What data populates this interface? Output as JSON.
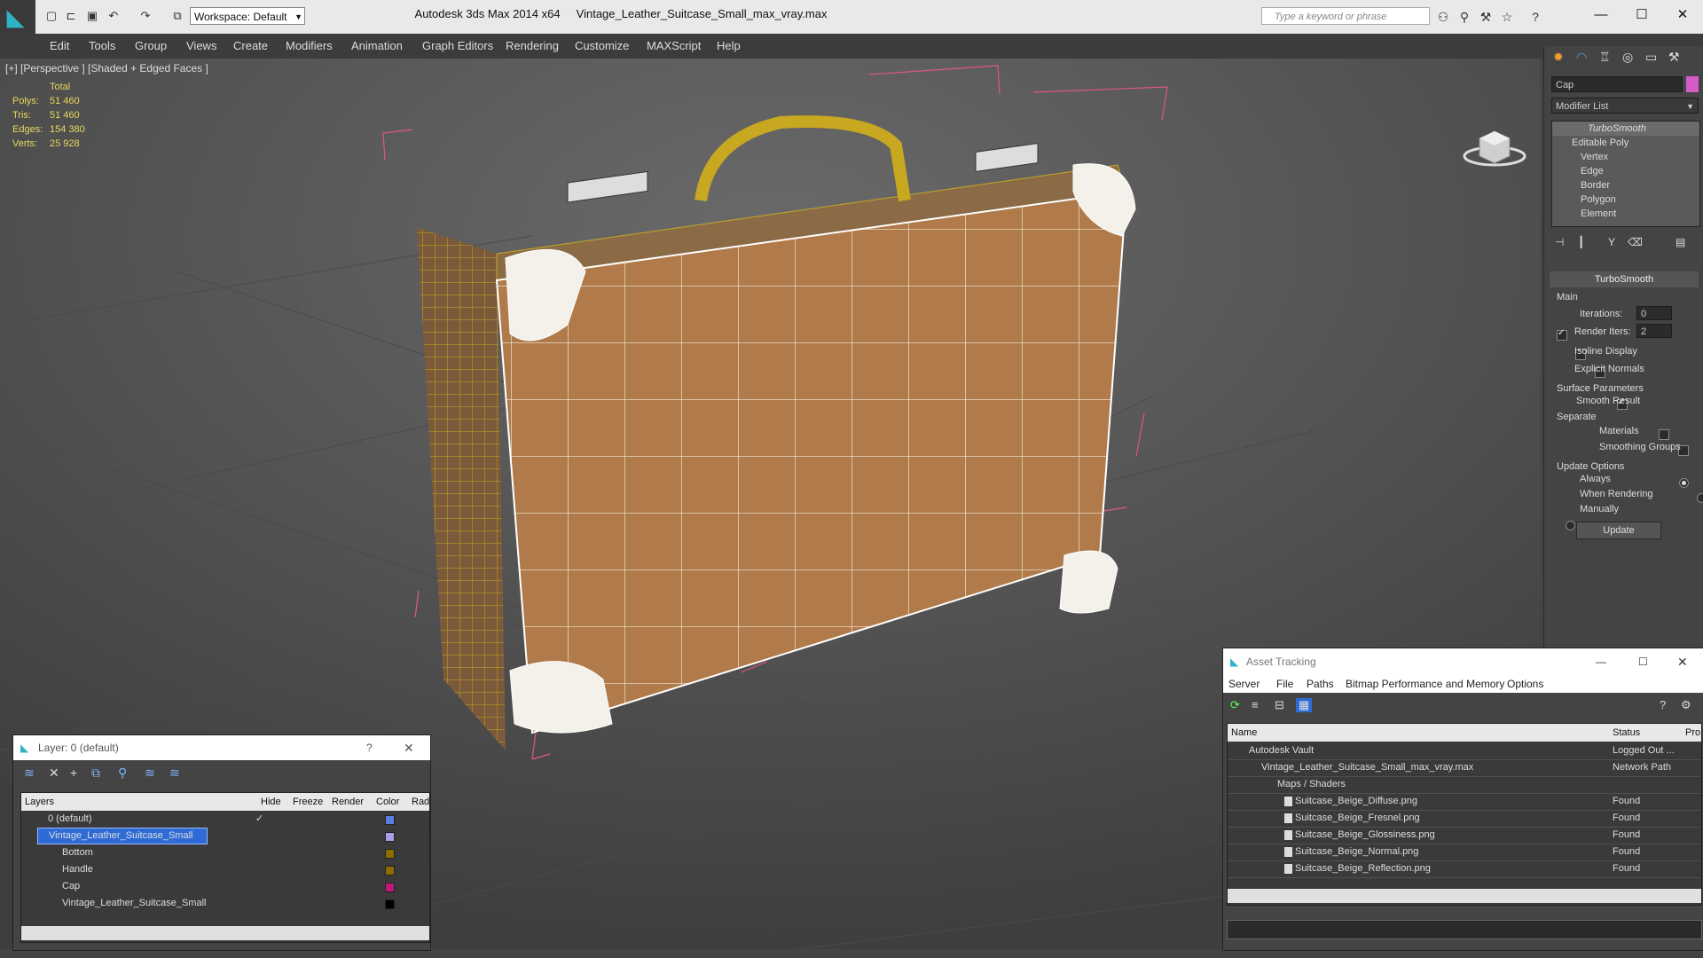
{
  "titlebar": {
    "workspace": "Workspace: Default",
    "app_title": "Autodesk 3ds Max  2014 x64",
    "file_name": "Vintage_Leather_Suitcase_Small_max_vray.max",
    "search_placeholder": "Type a keyword or phrase"
  },
  "menu": [
    "Edit",
    "Tools",
    "Group",
    "Views",
    "Create",
    "Modifiers",
    "Animation",
    "Graph Editors",
    "Rendering",
    "Customize",
    "MAXScript",
    "Help"
  ],
  "viewport": {
    "label": "[+] [Perspective ] [Shaded + Edged Faces ]",
    "stats_header": "Total",
    "stats": [
      {
        "label": "Polys:",
        "value": "51 460"
      },
      {
        "label": "Tris:",
        "value": "51 460"
      },
      {
        "label": "Edges:",
        "value": "154 380"
      },
      {
        "label": "Verts:",
        "value": "25 928"
      }
    ]
  },
  "command_panel": {
    "object_name": "Cap",
    "object_color": "#d65bc8",
    "modifier_list": "Modifier List",
    "stack": [
      "TurboSmooth",
      "Editable Poly",
      "Vertex",
      "Edge",
      "Border",
      "Polygon",
      "Element"
    ],
    "rollout_title": "TurboSmooth",
    "main_group": "Main",
    "iterations_label": "Iterations:",
    "iterations_value": "0",
    "render_iters_label": "Render Iters:",
    "render_iters_value": "2",
    "isoline_label": "Isoline Display",
    "explicit_label": "Explicit Normals",
    "surface_group": "Surface Parameters",
    "smooth_result": "Smooth Result",
    "separate_label": "Separate",
    "materials_label": "Materials",
    "smoothing_groups_label": "Smoothing Groups",
    "update_group": "Update Options",
    "always_label": "Always",
    "when_rendering_label": "When Rendering",
    "manually_label": "Manually",
    "update_button": "Update"
  },
  "layer_dialog": {
    "title": "Layer: 0 (default)",
    "help": "?",
    "columns": [
      "Layers",
      "Hide",
      "Freeze",
      "Render",
      "Color",
      "Rad"
    ],
    "rows": [
      {
        "name": "0 (default)",
        "color": "#5b7fe0",
        "indent": 0
      },
      {
        "name": "Vintage_Leather_Suitcase_Small",
        "color": "#a99ce8",
        "indent": 0,
        "selected": true
      },
      {
        "name": "Bottom",
        "color": "#8a6f00",
        "indent": 1
      },
      {
        "name": "Handle",
        "color": "#8a6f00",
        "indent": 1
      },
      {
        "name": "Cap",
        "color": "#c0177f",
        "indent": 1
      },
      {
        "name": "Vintage_Leather_Suitcase_Small",
        "color": "#000000",
        "indent": 1
      }
    ]
  },
  "asset_dialog": {
    "title": "Asset Tracking",
    "menu": [
      "Server",
      "File",
      "Paths",
      "Bitmap Performance and Memory",
      "Options"
    ],
    "columns": [
      "Name",
      "Status",
      "Pro"
    ],
    "rows": [
      {
        "name": "Autodesk Vault",
        "status": "Logged Out ...",
        "indent": 0
      },
      {
        "name": "Vintage_Leather_Suitcase_Small_max_vray.max",
        "status": "Network Path",
        "indent": 1
      },
      {
        "name": "Maps / Shaders",
        "status": "",
        "indent": 2
      },
      {
        "name": "Suitcase_Beige_Diffuse.png",
        "status": "Found",
        "indent": 3
      },
      {
        "name": "Suitcase_Beige_Fresnel.png",
        "status": "Found",
        "indent": 3
      },
      {
        "name": "Suitcase_Beige_Glossiness.png",
        "status": "Found",
        "indent": 3
      },
      {
        "name": "Suitcase_Beige_Normal.png",
        "status": "Found",
        "indent": 3
      },
      {
        "name": "Suitcase_Beige_Reflection.png",
        "status": "Found",
        "indent": 3
      }
    ]
  }
}
